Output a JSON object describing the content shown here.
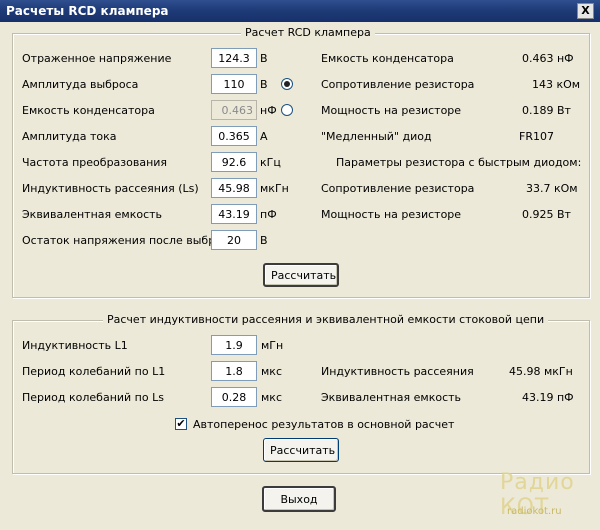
{
  "window": {
    "title": "Расчеты RCD клампера",
    "close_glyph": "X"
  },
  "group1": {
    "title": "Расчет RCD клампера",
    "rows": [
      {
        "label": "Отраженное напряжение",
        "value": "124.3",
        "unit": "В"
      },
      {
        "label": "Амплитуда выброса",
        "value": "110",
        "unit": "В"
      },
      {
        "label": "Емкость конденсатора",
        "value": "0.463",
        "unit": "нФ"
      },
      {
        "label": "Амплитуда тока",
        "value": "0.365",
        "unit": "А"
      },
      {
        "label": "Частота преобразования",
        "value": "92.6",
        "unit": "кГц"
      },
      {
        "label": "Индуктивность рассеяния (Ls)",
        "value": "45.98",
        "unit": "мкГн"
      },
      {
        "label": "Эквивалентная емкость",
        "value": "43.19",
        "unit": "пФ"
      },
      {
        "label": "Остаток напряжения после выброса",
        "value": "20",
        "unit": "В"
      }
    ],
    "results": [
      {
        "label": "Емкость конденсатора",
        "value": "0.463 нФ"
      },
      {
        "label": "Сопротивление резистора",
        "value": "143 кОм"
      },
      {
        "label": "Мощность на резисторе",
        "value": "0.189 Вт"
      },
      {
        "label": "\"Медленный\" диод",
        "value": "FR107"
      },
      {
        "label": "Параметры резистора с быстрым диодом:",
        "value": ""
      },
      {
        "label": "Сопротивление резистора",
        "value": "33.7 кОм"
      },
      {
        "label": "Мощность на резисторе",
        "value": "0.925 Вт"
      }
    ],
    "calc_button": "Рассчитать"
  },
  "group2": {
    "title": "Расчет индуктивности рассеяния и эквивалентной емкости стоковой цепи",
    "rows": [
      {
        "label": "Индуктивность L1",
        "value": "1.9",
        "unit": "мГн"
      },
      {
        "label": "Период колебаний по L1",
        "value": "1.8",
        "unit": "мкс"
      },
      {
        "label": "Период колебаний по Ls",
        "value": "0.28",
        "unit": "мкс"
      }
    ],
    "results": [
      {
        "label": "Индуктивность рассеяния",
        "value": "45.98 мкГн"
      },
      {
        "label": "Эквивалентная емкость",
        "value": "43.19 пФ"
      }
    ],
    "checkbox_label": "Автоперенос результатов в основной расчет",
    "calc_button": "Рассчитать"
  },
  "exit_button": "Выход",
  "watermark": {
    "line1": "Радио КОТ",
    "line2": "radiokot.ru"
  }
}
